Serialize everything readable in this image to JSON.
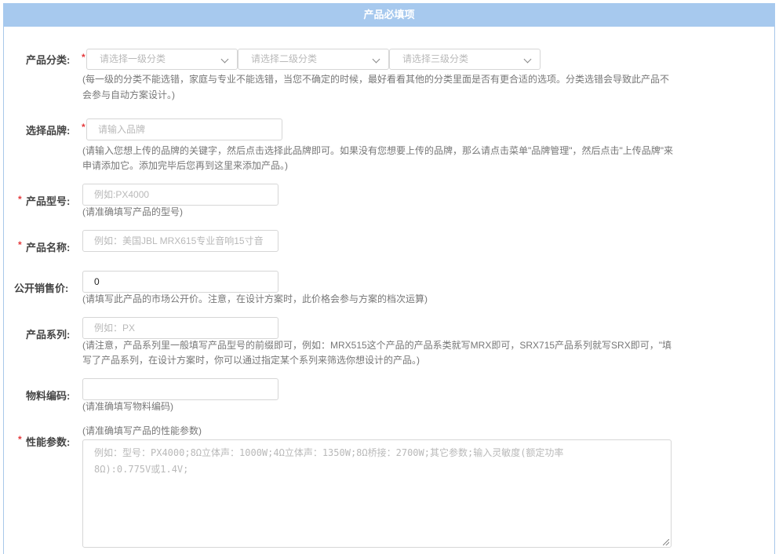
{
  "header": {
    "title": "产品必填项"
  },
  "fields": {
    "category": {
      "label": "产品分类:",
      "required": "*",
      "level1_placeholder": "请选择一级分类",
      "level2_placeholder": "请选择二级分类",
      "level3_placeholder": "请选择三级分类",
      "hint_line1": "(每一级的分类不能选错，家庭与专业不能选错，当您不确定的时候，最好看看其他的分类里面是否有更合适的选项。分类选错会导致此产品不",
      "hint_line2": "会参与自动方案设计。)"
    },
    "brand": {
      "label": "选择品牌:",
      "required": "*",
      "placeholder": "请输入品牌",
      "hint_line1": "(请输入您想上传的品牌的关键字，然后点击选择此品牌即可。如果没有您想要上传的品牌，那么请点击菜单\"品牌管理\"，然后点击\"上传品牌\"来",
      "hint_line2": "申请添加它。添加完毕后您再到这里来添加产品。)"
    },
    "model": {
      "label": "产品型号:",
      "required": "*",
      "placeholder": "例如:PX4000",
      "hint": "(请准确填写产品的型号)"
    },
    "name": {
      "label": "产品名称:",
      "required": "*",
      "placeholder": "例如：美国JBL MRX615专业音响15寸音"
    },
    "price": {
      "label": "公开销售价:",
      "value": "0",
      "hint": "(请填写此产品的市场公开价。注意，在设计方案时，此价格会参与方案的档次运算)"
    },
    "series": {
      "label": "产品系列:",
      "placeholder": "例如：PX",
      "hint_line1": "(请注意，产品系列里一般填写产品型号的前缀即可，例如：MRX515这个产品的产品系类就写MRX即可，SRX715产品系列就写SRX即可，\"填",
      "hint_line2": "写了产品系列，在设计方案时，你可以通过指定某个系列来筛选你想设计的产品。)"
    },
    "material_code": {
      "label": "物料编码:",
      "value": "",
      "hint": "(请准确填写物料编码)"
    },
    "specs": {
      "label": "性能参数:",
      "required": "*",
      "hint": "(请准确填写产品的性能参数)",
      "placeholder_line1": "例如：型号：PX4000;8Ω立体声：1000W;4Ω立体声：1350W;8Ω桥接：2700W;其它参数;输入灵敏度(额定功率",
      "placeholder_line2": "8Ω):0.775V或1.4V;"
    }
  },
  "colors": {
    "header_bg": "#a7c9ee",
    "required": "#e4393c",
    "border": "#d6d6d6",
    "placeholder": "#b9b9b9"
  },
  "icons": [
    "chevron-down-icon",
    "resize-handle-icon"
  ]
}
